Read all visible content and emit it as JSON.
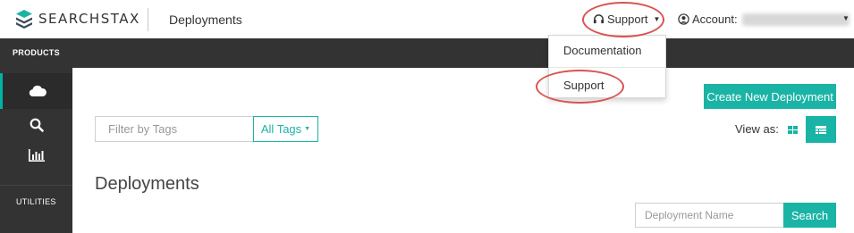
{
  "header": {
    "logo_text": "SEARCHSTAX",
    "page_label": "Deployments",
    "support_label": "Support",
    "account_label": "Account:"
  },
  "support_dropdown": {
    "items": [
      {
        "label": "Documentation"
      },
      {
        "label": "Support"
      }
    ]
  },
  "nav": {
    "products_label": "PRODUCTS",
    "utilities_label": "UTILITIES",
    "items": [
      {
        "icon": "cloud-icon",
        "active": true
      },
      {
        "icon": "search-icon",
        "active": false
      },
      {
        "icon": "bar-chart-icon",
        "active": false
      }
    ]
  },
  "main": {
    "create_button": "Create New Deployment",
    "filter_placeholder": "Filter by Tags",
    "tags_button": "All Tags",
    "view_as_label": "View as:",
    "heading": "Deployments",
    "name_placeholder": "Deployment Name",
    "search_button": "Search"
  },
  "colors": {
    "accent": "#1ab4a6",
    "dark_nav": "#333333",
    "annotation": "#d9534f"
  }
}
